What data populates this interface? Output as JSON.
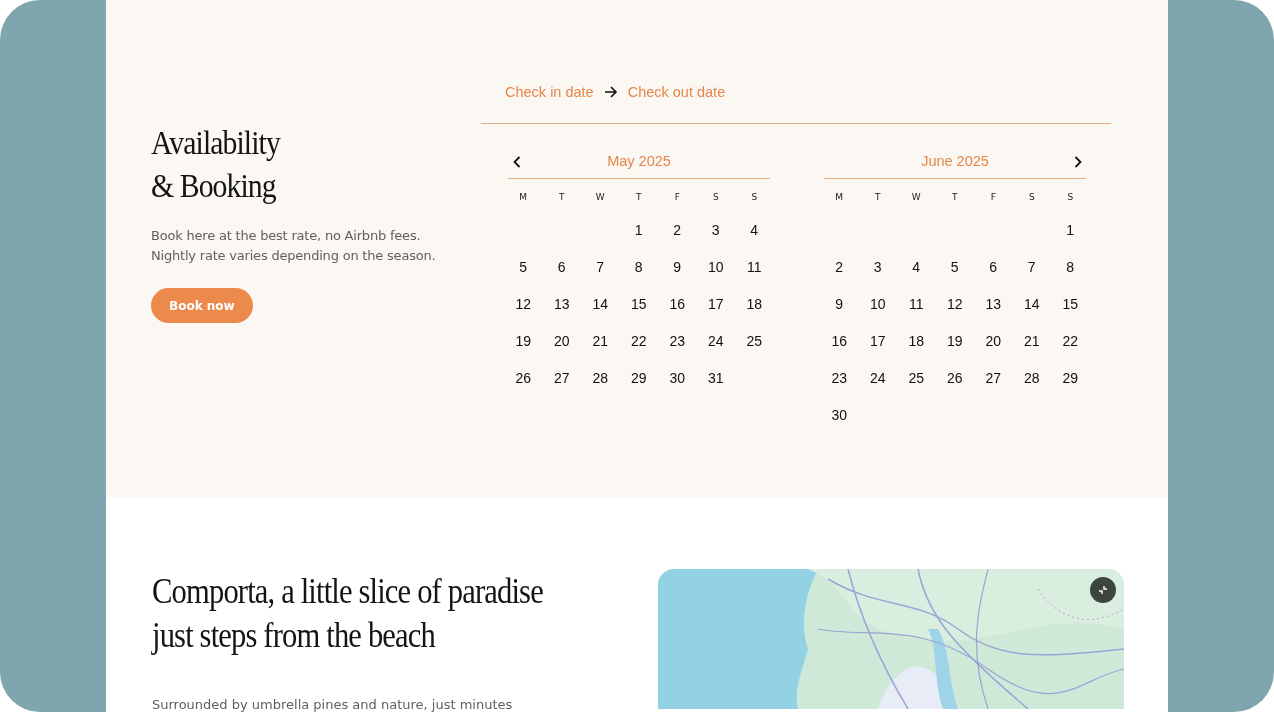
{
  "booking": {
    "heading_lines": [
      "Availability",
      "& Booking"
    ],
    "description_lines": [
      "Book here at the best rate, no Airbnb fees.",
      "Nightly rate varies depending on the season."
    ],
    "button": "Book now"
  },
  "date_range": {
    "check_in": "Check in date",
    "check_out": "Check out date"
  },
  "calendar": {
    "months": [
      {
        "title": "May 2025",
        "weekdays": [
          "M",
          "T",
          "W",
          "T",
          "F",
          "S",
          "S"
        ],
        "weeks": [
          [
            "1",
            "2",
            "3",
            "4"
          ],
          [
            "5",
            "6",
            "7",
            "8",
            "9",
            "10",
            "11"
          ],
          [
            "12",
            "13",
            "14",
            "15",
            "16",
            "17",
            "18"
          ],
          [
            "19",
            "20",
            "21",
            "22",
            "23",
            "24",
            "25"
          ],
          [
            "26",
            "27",
            "28",
            "29",
            "30",
            "31"
          ]
        ]
      },
      {
        "title": "June 2025",
        "weekdays": [
          "M",
          "T",
          "W",
          "T",
          "F",
          "S",
          "S"
        ],
        "weeks": [
          [
            "1"
          ],
          [
            "2",
            "3",
            "4",
            "5",
            "6",
            "7",
            "8"
          ],
          [
            "9",
            "10",
            "11",
            "12",
            "13",
            "14",
            "15"
          ],
          [
            "16",
            "17",
            "18",
            "19",
            "20",
            "21",
            "22"
          ],
          [
            "23",
            "24",
            "25",
            "26",
            "27",
            "28",
            "29"
          ],
          [
            "30"
          ]
        ]
      }
    ]
  },
  "about": {
    "heading_lines": [
      "Comporta, a little slice of paradise",
      "just steps from the beach"
    ],
    "text": "Surrounded by umbrella pines and nature, just minutes"
  }
}
